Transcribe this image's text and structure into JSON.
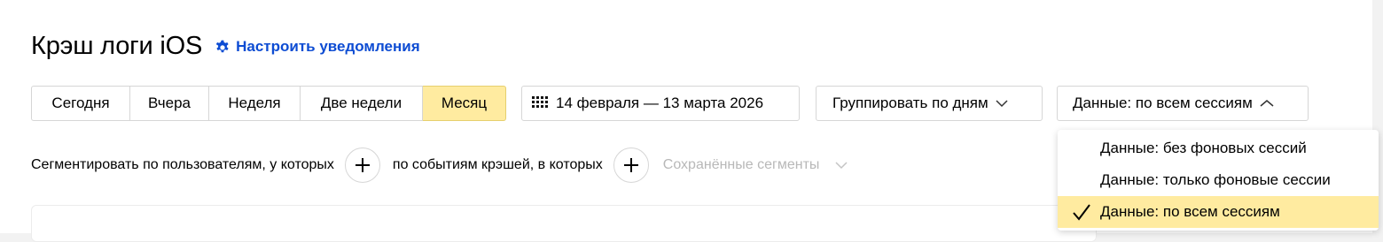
{
  "header": {
    "title": "Крэш логи iOS",
    "notify_link": "Настроить уведомления"
  },
  "periods": [
    "Сегодня",
    "Вчера",
    "Неделя",
    "Две недели",
    "Месяц"
  ],
  "active_period": "Месяц",
  "date_range": "14 февраля — 13 марта 2026",
  "group_by": "Группировать по дням",
  "data_filter": "Данные: по всем сессиям",
  "segment": {
    "users_label": "Сегментировать по пользователям, у которых",
    "events_label": "по событиям крэшей, в которых",
    "saved_label": "Сохранённые сегменты"
  },
  "dropdown": {
    "options": [
      "Данные: без фоновых сессий",
      "Данные: только фоновые сессии",
      "Данные: по всем сессиям"
    ],
    "selected_index": 2
  },
  "colors": {
    "accent": "#ffeba0",
    "link": "#0d4cd3"
  },
  "icons": [
    "gear-icon",
    "calendar-icon",
    "chevron-down-icon",
    "chevron-up-icon",
    "plus-icon",
    "check-icon"
  ]
}
